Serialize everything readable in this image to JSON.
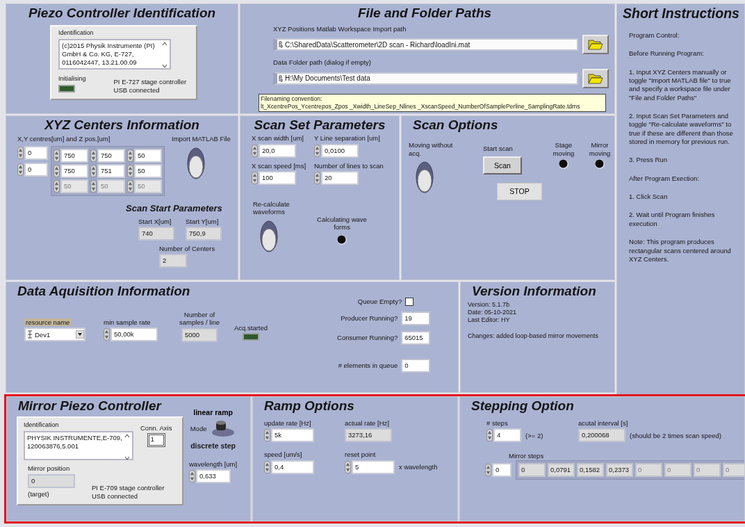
{
  "piezo": {
    "title": "Piezo Controller Identification",
    "id_label": "Identification",
    "id_text": "(c)2015 Physik Instrumente (PI) GmbH & Co. KG, E-727, 0116042447, 13.21.00.09",
    "led": {
      "label": "Initialising",
      "on": false
    },
    "status": [
      "PI E-727 stage controller",
      "USB connected"
    ]
  },
  "paths": {
    "title": "File and Folder Paths",
    "fields": [
      {
        "label": "XYZ Positions Matlab Workspace Import path",
        "value": "C:\\SharedData\\Scatterometer\\2D scan - Richard\\loadIni.mat"
      },
      {
        "label": "Data Folder path (dialog if empty)",
        "value": "H:\\My Documents\\Test data"
      }
    ],
    "note": [
      "Filenaming convention:",
      "lt_XcentrePos_Ycentrepos_Zpos _Xwidth_LineSep_Nlines _XscanSpeed_NumberOfSamplePerline_SamplingRate.tdms"
    ]
  },
  "xyz": {
    "title": "XYZ Centers Information",
    "array_label": "X,Y centres[um] and Z pos.[um]",
    "indices": [
      "0",
      "0"
    ],
    "rows": [
      {
        "values": [
          "750",
          "750",
          "50"
        ],
        "disabled": false
      },
      {
        "values": [
          "750",
          "751",
          "50"
        ],
        "disabled": false
      },
      {
        "values": [
          "50",
          "50",
          "50"
        ],
        "disabled": true
      }
    ],
    "import": {
      "label": "Import MATLAB File",
      "on": false
    },
    "start_title": "Scan Start Parameters",
    "start": [
      {
        "label": "Start X[um]",
        "value": "740"
      },
      {
        "label": "Start Y[um]",
        "value": "750,9"
      }
    ],
    "centers": {
      "label": "Number of Centers",
      "value": "2"
    }
  },
  "scan_set": {
    "title": "Scan Set Parameters",
    "fields": [
      {
        "label": "X scan width [um]",
        "value": "20,0"
      },
      {
        "label": "Y Line separation [um]",
        "value": "0,0100"
      },
      {
        "label": "X scan speed [ms]",
        "value": "100"
      },
      {
        "label": "Number of lines to scan",
        "value": "20"
      }
    ],
    "recalc": {
      "label": "Re-calculate waveforms",
      "on": false
    },
    "calc_led": {
      "label": "Calculating wave forms",
      "on": false
    }
  },
  "scan_options": {
    "title": "Scan Options",
    "moving": {
      "label": "Moving without acq.",
      "on": false
    },
    "start_label": "Start scan",
    "scan_button": "Scan",
    "leds": [
      {
        "label": "Stage moving",
        "on": false
      },
      {
        "label": "Mirror moving",
        "on": false
      }
    ],
    "stop_button": "STOP"
  },
  "instructions": {
    "title": "Short Instructions",
    "paragraphs": [
      "Program Control:",
      "Before Running Program:",
      "1. Input XYZ Centers manually or toggle \"Import MATLAB file\" to true and specify a workspace file under \"File and Folder Paths\"",
      "2. Input Scan Set Parameters and toggle \"Re-calculate waveforms\" to true if these are different than those stored in memory for previous run.",
      "3. Press Run",
      "After Program Exection:",
      "1. Click Scan",
      "2. Wait until Program finishes execution",
      "Note: This program produces rectangular scans centered around XYZ Centers."
    ]
  },
  "daq": {
    "title": "Data Aquisition Information",
    "resource": {
      "label": "resource name",
      "value": "Dev1"
    },
    "min_rate": {
      "label": "min sample rate",
      "value": "50,00k"
    },
    "samples": {
      "label": "Number of samples / line",
      "value": "5000"
    },
    "acq": {
      "label": "Acq.started",
      "on": false
    },
    "queue_empty": {
      "label": "Queue Empty?",
      "checked": false
    },
    "indicators": [
      {
        "label": "Producer Running?",
        "value": "19"
      },
      {
        "label": "Consumer Running?",
        "value": "65015"
      },
      {
        "label": "# elements in queue",
        "value": "0"
      }
    ]
  },
  "version": {
    "title": "Version Information",
    "lines": [
      "Version: 5.1.7b",
      "Date: 05-10-2021",
      "Last Editor: HY"
    ],
    "changes": "Changes: added loop-based mirror movements"
  },
  "mirror": {
    "title": "Mirror Piezo Controller",
    "id_label": "Identification",
    "id_text": "PHYSIK INSTRUMENTE,E-709, 120063876,5.001",
    "conn_axis": {
      "label": "Conn. Axis",
      "value": "1"
    },
    "position": {
      "label": "Mirror position",
      "value": "0",
      "note": "(target)"
    },
    "status": [
      "PI E-709 stage controller",
      "USB connected"
    ],
    "mode": {
      "label": "Mode",
      "options": [
        {
          "label": "linear ramp",
          "selected": true
        },
        {
          "label": "discrete step",
          "selected": false
        }
      ]
    },
    "wavelength": {
      "label": "wavelength [um]",
      "value": "0,633"
    }
  },
  "ramp": {
    "title": "Ramp Options",
    "update_rate": {
      "label": "update rate [Hz]",
      "value": "5k"
    },
    "actual_rate": {
      "label": "actual rate [Hz]",
      "value": "3273,16"
    },
    "speed": {
      "label": "speed [um/s]",
      "value": "0,4"
    },
    "reset": {
      "label": "reset point",
      "value": "5",
      "suffix": "x wavelength"
    }
  },
  "stepping": {
    "title": "Stepping Option",
    "steps": {
      "label": "# steps",
      "value": "4",
      "hint": "(>= 2)"
    },
    "interval": {
      "label": "acutal interval [s]",
      "value": "0,200068",
      "hint": "(should be 2 times scan speed)"
    },
    "mirror_steps": {
      "label": "Mirror steps",
      "index": "0",
      "items": [
        {
          "value": "0",
          "disabled": false
        },
        {
          "value": "0,0791",
          "disabled": false
        },
        {
          "value": "0,1582",
          "disabled": false
        },
        {
          "value": "0,2373",
          "disabled": false
        },
        {
          "value": "0",
          "disabled": true
        },
        {
          "value": "0",
          "disabled": true
        },
        {
          "value": "0",
          "disabled": true
        },
        {
          "value": "0",
          "disabled": true
        }
      ]
    }
  }
}
